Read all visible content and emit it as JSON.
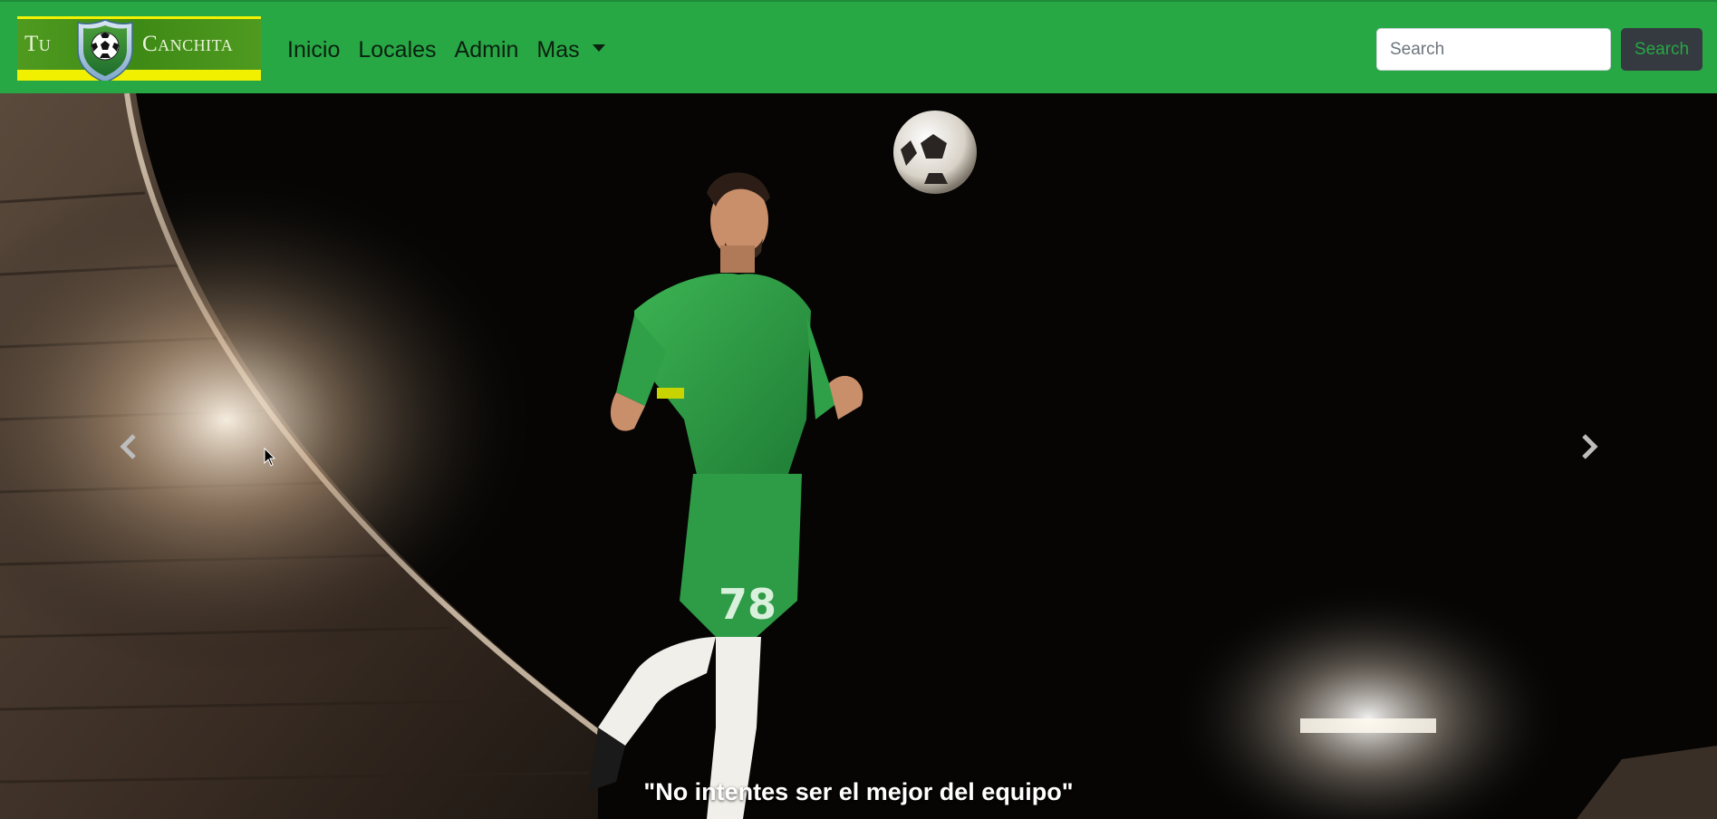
{
  "brand": {
    "logo_text_left": "Tu",
    "logo_text_right": "Canchita",
    "logo_icon": "soccer-ball-shield-icon"
  },
  "nav": {
    "items": [
      {
        "label": "Inicio"
      },
      {
        "label": "Locales"
      },
      {
        "label": "Admin"
      },
      {
        "label": "Mas",
        "dropdown": true
      }
    ]
  },
  "search": {
    "placeholder": "Search",
    "value": "",
    "button_label": "Search"
  },
  "carousel": {
    "caption": "\"No intentes ser el mejor del equipo\"",
    "prev_icon": "chevron-left-icon",
    "next_icon": "chevron-right-icon",
    "slide_description_icon": "soccer-player-header-image"
  },
  "colors": {
    "navbar": "#28a745",
    "button_bg": "#343a40",
    "button_text": "#28a745",
    "jersey": "#2e9b46",
    "logo_yellow": "#f0f000"
  }
}
